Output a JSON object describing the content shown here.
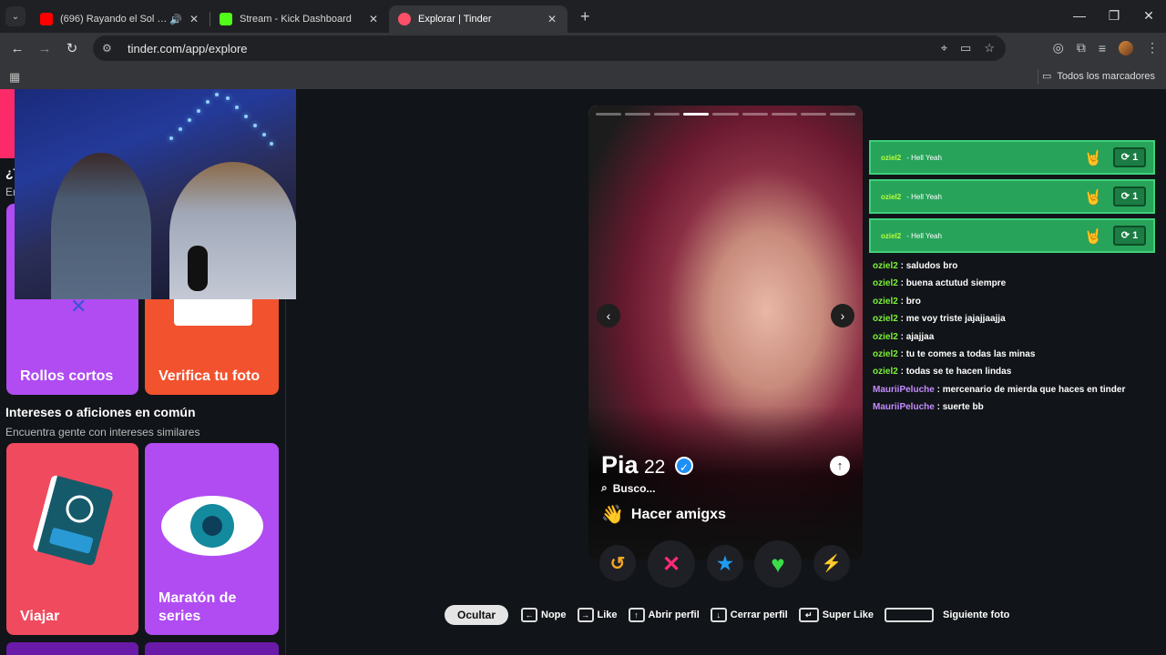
{
  "browser": {
    "tabs": [
      {
        "title": "(696) Rayando el Sol - YouTube",
        "fav_color": "#ff0000",
        "audio": "🔊"
      },
      {
        "title": "Stream - Kick Dashboard",
        "fav_color": "#53fc18"
      },
      {
        "title": "Explorar | Tinder",
        "fav_color": "#fd5068"
      }
    ],
    "new_tab": "+",
    "close": "✕",
    "url": "tinder.com/app/explore",
    "bookmarks_label": "Todos los marcadores",
    "window": {
      "min": "—",
      "max": "❐",
      "close": "✕"
    }
  },
  "sidebar": {
    "question": "¿T",
    "sub": "En",
    "cards_top": [
      {
        "label": "Rollos cortos",
        "color": "#b04cf2"
      },
      {
        "label": "Verifica tu foto",
        "color": "#f2522e"
      }
    ],
    "section_title": "Intereses o aficiones en común",
    "section_sub": "Encuentra gente con intereses similares",
    "cards_bottom": [
      {
        "label": "Viajar",
        "color": "#f04a5e"
      },
      {
        "label": "Maratón de series",
        "color": "#b04cf2"
      }
    ]
  },
  "profile": {
    "name": "Pia",
    "age": "22",
    "looking_label": "Busco...",
    "looking_value": "Hacer amigxs",
    "photo_count": 9,
    "active_photo": 3
  },
  "actions": [
    {
      "name": "rewind",
      "glyph": "↺",
      "color": "#f5a623"
    },
    {
      "name": "nope",
      "glyph": "✕",
      "color": "#ff2a7a"
    },
    {
      "name": "super-like",
      "glyph": "★",
      "color": "#1e9cf0"
    },
    {
      "name": "like",
      "glyph": "♥",
      "color": "#3ddc4a"
    },
    {
      "name": "boost",
      "glyph": "⚡",
      "color": "#a64dff"
    }
  ],
  "chat": {
    "highlights": [
      {
        "user": "oziel2",
        "msg": "- Hell Yeah",
        "count": "1"
      },
      {
        "user": "oziel2",
        "msg": "- Hell Yeah",
        "count": "1"
      },
      {
        "user": "oziel2",
        "msg": "- Hell Yeah",
        "count": "1"
      }
    ],
    "messages": [
      {
        "user": "oziel2",
        "text": "saludos bro",
        "color": "green"
      },
      {
        "user": "oziel2",
        "text": "buena actutud siempre",
        "color": "green"
      },
      {
        "user": "oziel2",
        "text": "bro",
        "color": "green"
      },
      {
        "user": "oziel2",
        "text": "me voy triste jajajjaajja",
        "color": "green"
      },
      {
        "user": "oziel2",
        "text": "ajajjaa",
        "color": "green"
      },
      {
        "user": "oziel2",
        "text": "tu te comes a todas las minas",
        "color": "green"
      },
      {
        "user": "oziel2",
        "text": "todas se te hacen lindas",
        "color": "green"
      },
      {
        "user": "MauriiPeluche",
        "text": "mercenario de mierda que haces en tinder",
        "color": "purple"
      },
      {
        "user": "MauriiPeluche",
        "text": "suerte bb",
        "color": "purple"
      }
    ]
  },
  "hints": {
    "hide": "Ocultar",
    "nope": "Nope",
    "like": "Like",
    "open": "Abrir perfil",
    "close": "Cerrar perfil",
    "super": "Super Like",
    "next": "Siguiente foto"
  }
}
